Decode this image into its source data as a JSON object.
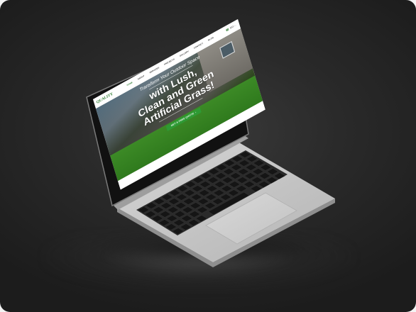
{
  "scene": {
    "background_color": "#2a2a2a",
    "laptop_color": "#c9c9c9",
    "keyboard_color": "#1e1e1e"
  },
  "site": {
    "logo_text": "QUALITY",
    "nav": {
      "items": [
        "HOME",
        "ABOUT",
        "SERVICES",
        "PROJECTS",
        "GALLERY",
        "CONTACT",
        "BLOG"
      ],
      "phone": "561-..."
    },
    "hero": {
      "kicker": "Transform Your Outdoor Space",
      "headline_1": "with Lush,",
      "headline_2": "Clean and Green",
      "headline_3": "Artificial Grass!",
      "cta_label": "GET A FREE QUOTE"
    },
    "accent_color": "#2e9a34"
  }
}
